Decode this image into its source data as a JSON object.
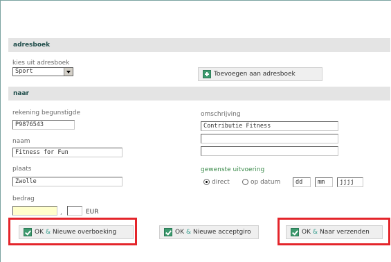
{
  "adresboek": {
    "header": "adresboek",
    "select_label": "kies uit adresboek",
    "select_value": "Sport",
    "add_button": "Toevoegen aan adresboek"
  },
  "naar": {
    "header": "naar",
    "rekening_label": "rekening begunstigde",
    "rekening_value": "P9876543",
    "naam_label": "naam",
    "naam_value": "Fitness for Fun",
    "plaats_label": "plaats",
    "plaats_value": "Zwolle",
    "bedrag_label": "bedrag",
    "bedrag_value": "",
    "bedrag_cents": "",
    "comma": ",",
    "currency": "EUR",
    "omschrijving_label": "omschrijving",
    "omschrijving_lines": [
      "Contributie Fitness",
      "",
      "",
      ""
    ],
    "uitvoering_label": "gewenste uitvoering",
    "option_direct": "direct",
    "option_op_datum": "op datum",
    "date_dd": "dd",
    "date_mm": "mm",
    "date_jjjj": "jjjj"
  },
  "actions": {
    "ok": "OK",
    "amp": "&",
    "nieuwe_overboeking": "Nieuwe overboeking",
    "nieuwe_acceptgiro": "Nieuwe acceptgiro",
    "naar_verzenden": "Naar verzenden"
  }
}
